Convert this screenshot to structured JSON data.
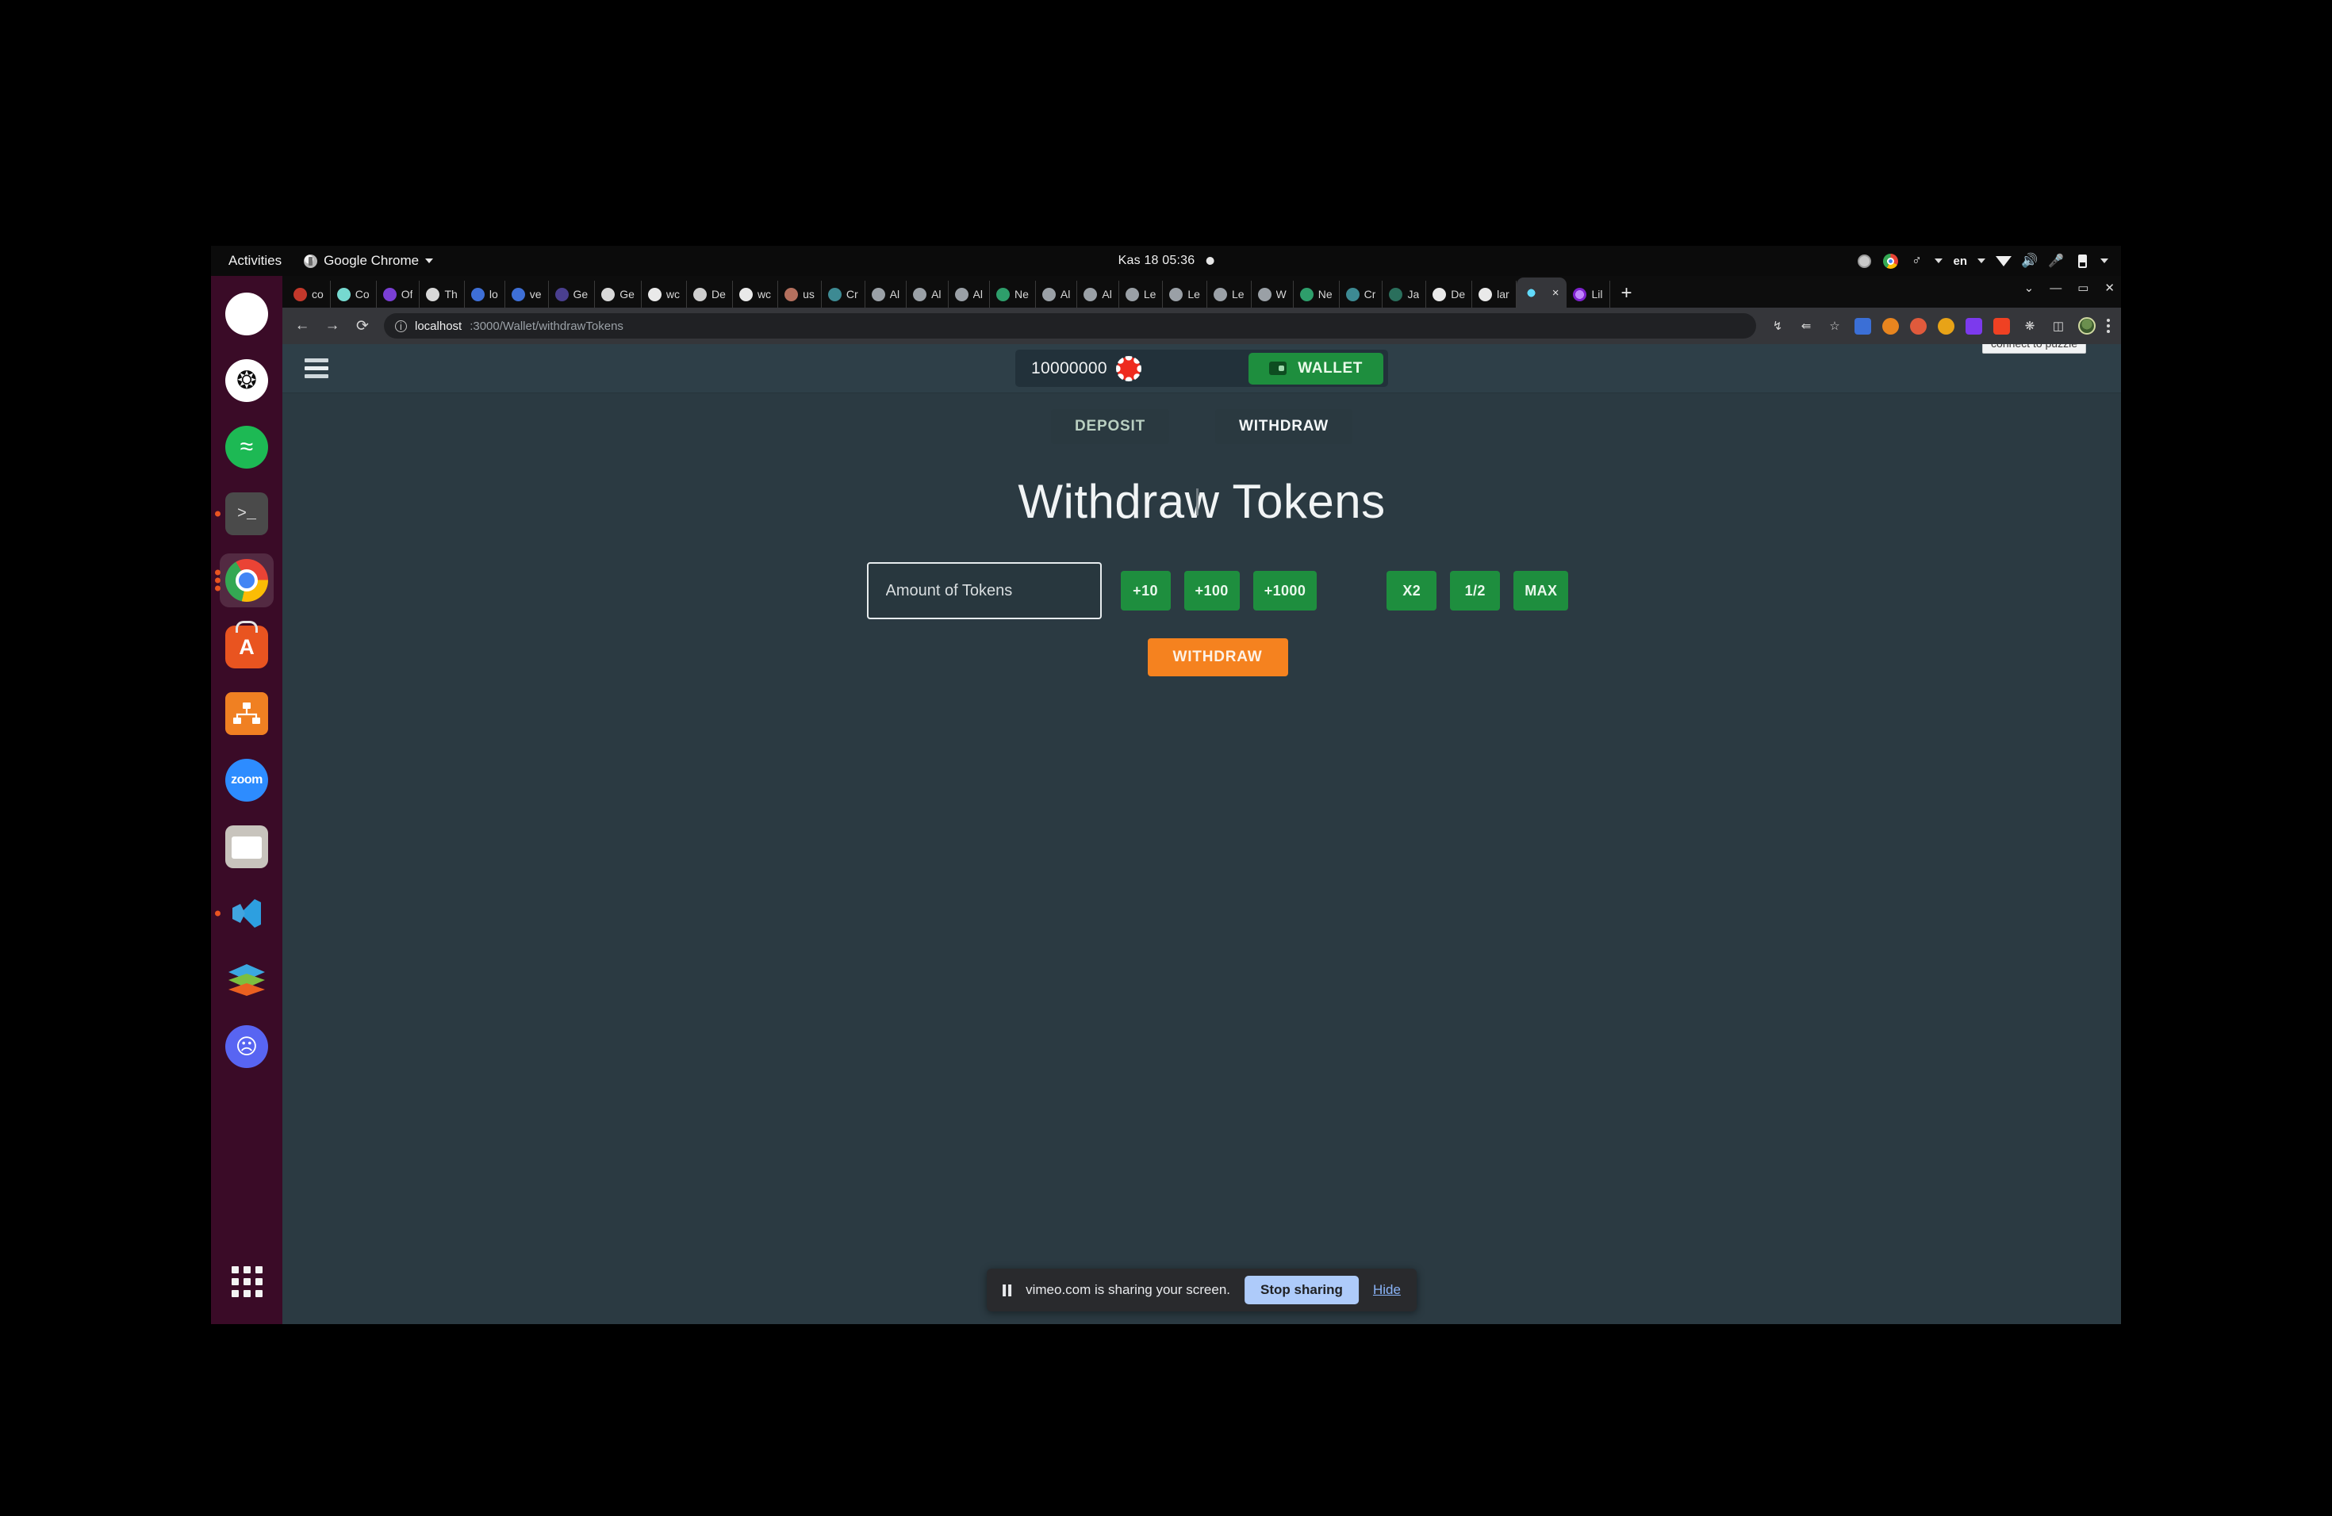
{
  "topbar": {
    "activities": "Activities",
    "app_menu": "Google Chrome",
    "clock": "Kas 18  05:36",
    "language": "en"
  },
  "dock": {
    "items": [
      {
        "name": "slack",
        "glyph": "✦"
      },
      {
        "name": "chatgpt",
        "glyph": "✸"
      },
      {
        "name": "spotify",
        "glyph": "≋"
      },
      {
        "name": "terminal",
        "glyph": ">_"
      },
      {
        "name": "google-chrome",
        "glyph": ""
      },
      {
        "name": "ubuntu-software",
        "glyph": "A"
      },
      {
        "name": "org-chart-app",
        "glyph": ""
      },
      {
        "name": "zoom",
        "glyph": "zoom"
      },
      {
        "name": "files",
        "glyph": ""
      },
      {
        "name": "vs-code",
        "glyph": "✂"
      },
      {
        "name": "layers-app",
        "glyph": ""
      },
      {
        "name": "discord",
        "glyph": "◕‿◕"
      }
    ],
    "show_apps_label": "Show Applications"
  },
  "browser": {
    "tabs": [
      {
        "label": "co",
        "color": "#c3382b"
      },
      {
        "label": "Co",
        "color": "#76d9d0"
      },
      {
        "label": "Of",
        "color": "#7a3fd4"
      },
      {
        "label": "Th",
        "color": "#d8d8d8"
      },
      {
        "label": "lo",
        "color": "#3e6fd6"
      },
      {
        "label": "ve",
        "color": "#3e6fd6"
      },
      {
        "label": "Ge",
        "color": "#4a3f8f"
      },
      {
        "label": "Ge",
        "color": "#d8d8d8"
      },
      {
        "label": "wc",
        "color": "#e9e9e9"
      },
      {
        "label": "De",
        "color": "#cfcfcf"
      },
      {
        "label": "wc",
        "color": "#e9e9e9"
      },
      {
        "label": "us",
        "color": "#b4705e"
      },
      {
        "label": "Cr",
        "color": "#3d8a93"
      },
      {
        "label": "Al",
        "color": "#9aa0a6"
      },
      {
        "label": "Al",
        "color": "#9aa0a6"
      },
      {
        "label": "Al",
        "color": "#9aa0a6"
      },
      {
        "label": "Ne",
        "color": "#2e9e6b"
      },
      {
        "label": "Al",
        "color": "#9aa0a6"
      },
      {
        "label": "Al",
        "color": "#9aa0a6"
      },
      {
        "label": "Le",
        "color": "#9aa0a6"
      },
      {
        "label": "Le",
        "color": "#9aa0a6"
      },
      {
        "label": "Le",
        "color": "#9aa0a6"
      },
      {
        "label": "W",
        "color": "#9aa0a6"
      },
      {
        "label": "Ne",
        "color": "#2e9e6b"
      },
      {
        "label": "Cr",
        "color": "#3d8a93"
      },
      {
        "label": "Ja",
        "color": "#2a6f5c"
      },
      {
        "label": "De",
        "color": "#e9e9e9"
      },
      {
        "label": "lar",
        "color": "#e9e9e9"
      }
    ],
    "active_tab": {
      "label": "",
      "close_label": "×",
      "color": "#61dafb"
    },
    "pinned_last_tab": {
      "label": "Lil",
      "color": "#a855f7"
    },
    "new_tab_label": "+",
    "window_controls": {
      "minimize": "—",
      "maximize": "▭",
      "close": "✕"
    },
    "nav": {
      "back": "←",
      "forward": "→",
      "reload": "⟳"
    },
    "url": {
      "info": "ⓘ",
      "host": "localhost",
      "path": ":3000/Wallet/withdrawTokens"
    },
    "toolbar_icons": [
      "install-icon",
      "share-icon",
      "bookmark-star-icon",
      "extension-blue-icon",
      "extension-fox-icon",
      "extension-red-icon",
      "extension-yellow-icon",
      "extension-purple-icon",
      "extension-orange-icon",
      "extensions-puzzle-icon",
      "side-panel-icon",
      "profile-avatar",
      "chrome-menu-icon"
    ]
  },
  "app": {
    "menu_icon": "hamburger-menu",
    "balance": "10000000",
    "token_icon": "red-token-coin",
    "wallet_button": "WALLET",
    "tooltip": "connect to puzzle",
    "tabs": [
      {
        "label": "DEPOSIT",
        "active": false
      },
      {
        "label": "WITHDRAW",
        "active": true
      }
    ],
    "title": "Withdraw Tokens",
    "input_placeholder": "Amount of Tokens",
    "input_value": "",
    "quick_buttons": [
      "+10",
      "+100",
      "+1000"
    ],
    "modifier_buttons": [
      "X2",
      "1/2",
      "MAX"
    ],
    "submit_button": "WITHDRAW"
  },
  "share_notification": {
    "text": "vimeo.com is sharing your screen.",
    "stop_label": "Stop sharing",
    "hide_label": "Hide"
  },
  "colors": {
    "accent_green": "#1e8e3e",
    "accent_orange": "#f5821f",
    "page_bg": "#2b3a42",
    "token_red": "#ee2b1f"
  }
}
